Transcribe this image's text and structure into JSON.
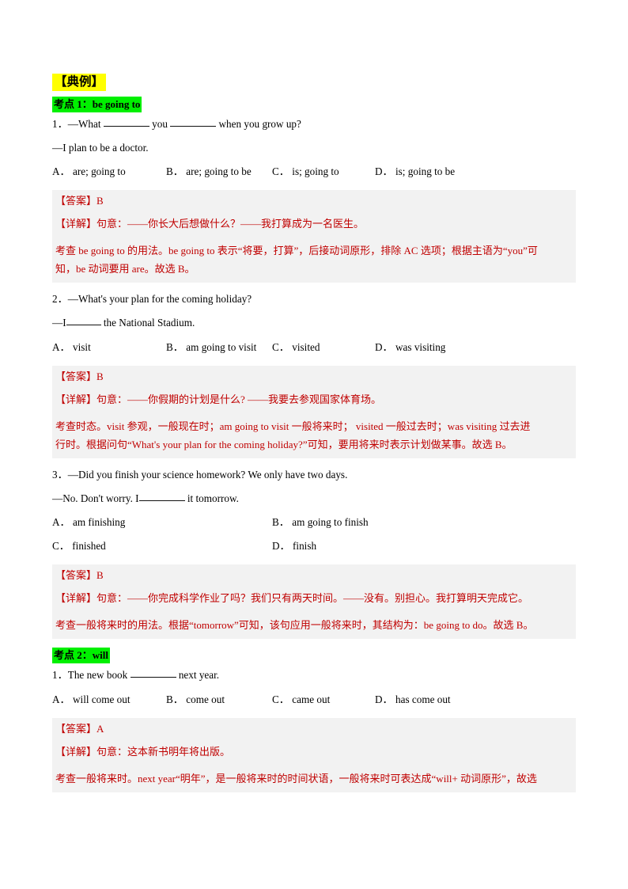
{
  "document": {
    "title": "【典例】",
    "highlight_colors": {
      "title_highlight": "#ffff00",
      "section_highlight": "#00f000",
      "answer_block_bg": "#f2f2f2",
      "answer_text": "#c00000"
    }
  },
  "sections": [
    {
      "heading": "考点 1：be going to",
      "questions": [
        {
          "number": "1．",
          "stem": "—What ________ you ________ when you grow up?",
          "stem_parts": [
            "—What",
            "you",
            "when you grow up?"
          ],
          "reply": "—I plan to be a doctor.",
          "options": [
            {
              "key": "A．",
              "text": "are; going to"
            },
            {
              "key": "B．",
              "text": "are; going to be"
            },
            {
              "key": "C．",
              "text": "is; going to"
            },
            {
              "key": "D．",
              "text": "is; going to be"
            }
          ],
          "answer_label": "【答案】",
          "answer_value": "B",
          "explain_label": "【详解】",
          "explain_intro": "句意：——你长大后想做什么？——我打算成为一名医生。",
          "explain_body": [
            "考查 be going to 的用法。be going to 表示“将要，打算”，后接动词原形，排除 AC 选项；根据主语为“you”可",
            "知，be 动词要用 are。故选 B。"
          ]
        },
        {
          "number": "2．",
          "stem": "—What's your plan for the coming holiday?",
          "reply_parts": [
            "—I",
            "the National Stadium."
          ],
          "options": [
            {
              "key": "A．",
              "text": "visit"
            },
            {
              "key": "B．",
              "text": "am going to visit"
            },
            {
              "key": "C．",
              "text": "visited"
            },
            {
              "key": "D．",
              "text": "was visiting"
            }
          ],
          "answer_label": "【答案】",
          "answer_value": "B",
          "explain_label": "【详解】",
          "explain_intro": "句意：——你假期的计划是什么? ——我要去参观国家体育场。",
          "explain_body": [
            "考查时态。visit 参观，一般现在时；am going to visit 一般将来时； visited 一般过去时；was visiting 过去进",
            "行时。根据问句“What's your plan for the coming holiday?”可知，要用将来时表示计划做某事。故选 B。"
          ]
        },
        {
          "number": "3．",
          "stem": "—Did you finish your science homework? We only have two days.",
          "reply_parts": [
            "—No. Don't worry. I",
            "it tomorrow."
          ],
          "options": [
            {
              "key": "A．",
              "text": "am finishing"
            },
            {
              "key": "B．",
              "text": "am going to finish"
            },
            {
              "key": "C．",
              "text": "finished"
            },
            {
              "key": "D．",
              "text": "finish"
            }
          ],
          "answer_label": "【答案】",
          "answer_value": "B",
          "explain_label": "【详解】",
          "explain_intro": "句意：——你完成科学作业了吗？我们只有两天时间。——没有。别担心。我打算明天完成它。",
          "explain_body": [
            "考查一般将来时的用法。根据“tomorrow”可知，该句应用一般将来时，其结构为：be going to do。故选 B。"
          ]
        }
      ]
    },
    {
      "heading": "考点 2：will",
      "questions": [
        {
          "number": "1．",
          "stem_parts": [
            "The new book",
            "next year."
          ],
          "options": [
            {
              "key": "A．",
              "text": "will come out"
            },
            {
              "key": "B．",
              "text": "come out"
            },
            {
              "key": "C．",
              "text": "came out"
            },
            {
              "key": "D．",
              "text": "has come out"
            }
          ],
          "answer_label": "【答案】",
          "answer_value": "A",
          "explain_label": "【详解】",
          "explain_intro": "句意：这本新书明年将出版。",
          "explain_body": [
            "考查一般将来时。next year“明年”，是一般将来时的时间状语，一般将来时可表达成“will+ 动词原形”，故选"
          ]
        }
      ]
    }
  ]
}
